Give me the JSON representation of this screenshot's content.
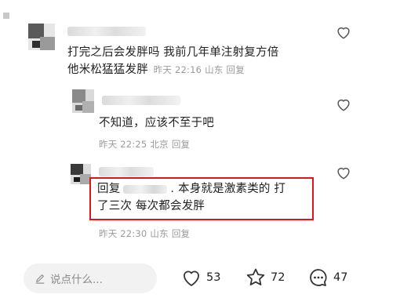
{
  "comments": [
    {
      "text_line1": "打完之后会发胖吗 我前几年单注射复方倍",
      "text_line2": "他米松猛猛发胖",
      "time": "昨天 22:16",
      "location": "山东",
      "reply_label": "回复"
    },
    {
      "text": "不知道，应该不至于吧",
      "time": "昨天 22:25",
      "location": "北京",
      "reply_label": "回复"
    },
    {
      "reply_prefix": "回复",
      "text_after_name": ". 本身就是激素类的 打",
      "text_line2": "了三次 每次都会发胖",
      "time": "昨天 22:30",
      "location": "山东",
      "reply_label": "回复"
    }
  ],
  "bottom_bar": {
    "input_placeholder": "说点什么...",
    "like_count": "53",
    "star_count": "72",
    "comment_count": "47"
  },
  "colors": {
    "highlight_border": "#e0141e",
    "meta_text": "#9a9a9a"
  }
}
